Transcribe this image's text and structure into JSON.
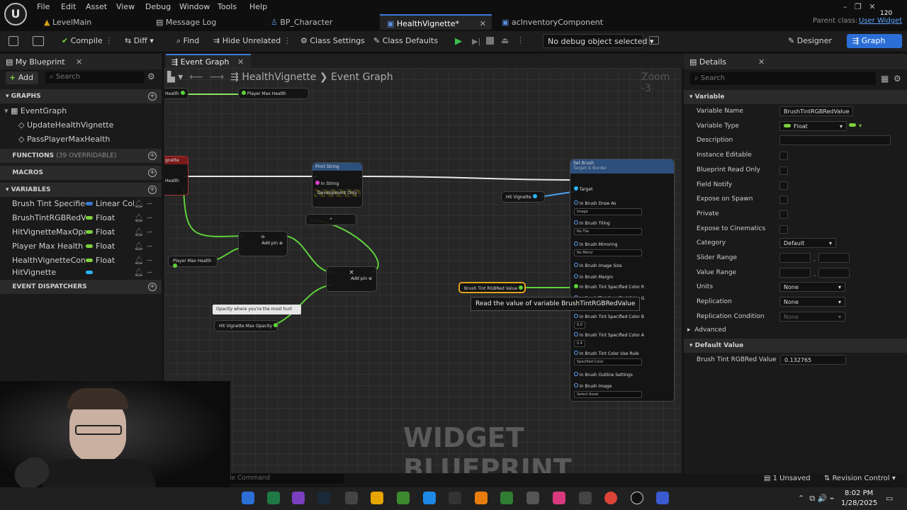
{
  "menu": [
    "File",
    "Edit",
    "Asset",
    "View",
    "Debug",
    "Window",
    "Tools",
    "Help"
  ],
  "tabs": [
    "LevelMain",
    "Message Log",
    "BP_Character",
    "HealthVignette*",
    "acInventoryComponent"
  ],
  "window": {
    "fps": "120",
    "parent_label": "Parent class:",
    "parent_value": "User Widget"
  },
  "toolbar": {
    "compile": "Compile",
    "diff": "Diff",
    "find": "Find",
    "hide_unrelated": "Hide Unrelated",
    "class_settings": "Class Settings",
    "class_defaults": "Class Defaults",
    "debug_object": "No debug object selected",
    "designer": "Designer",
    "graph": "Graph"
  },
  "my_blueprint": {
    "title": "My Blueprint",
    "add": "Add",
    "search_placeholder": "Search",
    "graphs_header": "GRAPHS",
    "graphs": [
      "EventGraph",
      "UpdateHealthVignette",
      "PassPlayerMaxHealth"
    ],
    "functions_header": "FUNCTIONS",
    "functions_count": "(39 OVERRIDABLE)",
    "macros_header": "MACROS",
    "variables_header": "VARIABLES",
    "variables": [
      {
        "name": "Brush Tint Specified C",
        "type": "Linear Colc",
        "color": "#3a7bd5"
      },
      {
        "name": "BrushTintRGBRedValu",
        "type": "Float",
        "color": "#7bd13b"
      },
      {
        "name": "HitVignetteMaxOpacit",
        "type": "Float",
        "color": "#7bd13b"
      },
      {
        "name": "Player Max Health",
        "type": "Float",
        "color": "#7bd13b"
      },
      {
        "name": "HealthVignetteConsta",
        "type": "Float",
        "color": "#7bd13b"
      },
      {
        "name": "HitVignette",
        "type": "",
        "color": "#29b6f6"
      }
    ],
    "dispatchers_header": "EVENT DISPATCHERS"
  },
  "graph": {
    "tab": "Event Graph",
    "breadcrumb_root": "HealthVignette",
    "breadcrumb_sep": "❯",
    "breadcrumb_leaf": "Event Graph",
    "zoom": "Zoom -3",
    "watermark": "WIDGET BLUEPRINT",
    "tooltip": "Read the value of variable BrushTintRGBRedValue",
    "console_placeholder": "le Command",
    "nodes": {
      "player_max_health_top": "Player Max Health",
      "health_top": "Health",
      "vignette_event": "gnette",
      "health_mid": "Health",
      "print_string": "Print String",
      "in_string": "In String",
      "dev_only": "Development Only",
      "divide_symbol": "÷",
      "multiply_symbol": "×",
      "add_pin": "Add pin",
      "player_max_health": "Player Max Health",
      "comment": "Opacity where you're the most hurt",
      "hit_vignette_max_opacity": "Hit Vignette Max Opacity",
      "hit_vignette": "Hit Vignette",
      "brush_tint_red": "Brush Tint RGBRed Value",
      "set_brush": "Set Brush",
      "set_brush_sub": "Target is Border",
      "set_pins": [
        "Target",
        "In Brush Draw As",
        "In Brush Tiling",
        "In Brush Mirroring",
        "In Brush Image Size",
        "In Brush Margin",
        "In Brush Tint Specified Color R",
        "In Brush Tint Specified Color G",
        "In Brush Tint Specified Color B",
        "In Brush Tint Specified Color A",
        "In Brush Tint Color Use Rule",
        "In Brush Outline Settings",
        "In Brush Image"
      ],
      "set_dropdowns": [
        "Image",
        "No Tile",
        "No Mirror",
        "Specified Color",
        "Select Asset"
      ],
      "set_values": [
        "0.0",
        "0.4"
      ]
    }
  },
  "details": {
    "title": "Details",
    "search_placeholder": "Search",
    "variable_header": "Variable",
    "rows": [
      {
        "label": "Variable Name",
        "value": "BrushTintRGBRedValue"
      },
      {
        "label": "Variable Type",
        "value": "Float"
      },
      {
        "label": "Description",
        "value": ""
      },
      {
        "label": "Instance Editable",
        "value": ""
      },
      {
        "label": "Blueprint Read Only",
        "value": ""
      },
      {
        "label": "Field Notify",
        "value": ""
      },
      {
        "label": "Expose on Spawn",
        "value": ""
      },
      {
        "label": "Private",
        "value": ""
      },
      {
        "label": "Expose to Cinematics",
        "value": ""
      },
      {
        "label": "Category",
        "value": "Default"
      },
      {
        "label": "Slider Range",
        "value": ""
      },
      {
        "label": "Value Range",
        "value": ""
      },
      {
        "label": "Units",
        "value": "None"
      },
      {
        "label": "Replication",
        "value": "None"
      },
      {
        "label": "Replication Condition",
        "value": "None"
      }
    ],
    "advanced": "Advanced",
    "default_header": "Default Value",
    "default_label": "Brush Tint RGBRed Value",
    "default_value": "0.132765"
  },
  "status": {
    "unsaved": "1 Unsaved",
    "revision": "Revision Control"
  },
  "taskbar": {
    "time": "8:02 PM",
    "date": "1/28/2025"
  }
}
